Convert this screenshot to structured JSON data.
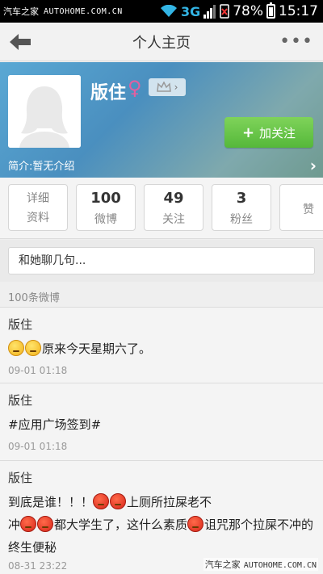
{
  "status_bar": {
    "watermark": "汽车之家",
    "domain": "AUTOHOME.COM.CN",
    "network": "3G",
    "battery": "78%",
    "battery_level": 0.78,
    "time": "15:17"
  },
  "header": {
    "title": "个人主页",
    "more": "•••"
  },
  "profile": {
    "username": "版住",
    "gender_icon": "female-icon",
    "gender_color": "#e35fa0",
    "follow_label": "加关注",
    "follow_color": "#5fbe43",
    "bio": "简介:暂无介绍"
  },
  "stats": {
    "details_line1": "详细",
    "details_line2": "资料",
    "weibo_num": "100",
    "weibo_label": "微博",
    "following_num": "49",
    "following_label": "关注",
    "fans_num": "3",
    "fans_label": "粉丝",
    "likes_label": "赞"
  },
  "chat": {
    "placeholder": "和她聊几句..."
  },
  "feed": {
    "count_label": "100条微博",
    "posts": [
      {
        "author": "版住",
        "text": "原来今天星期六了。",
        "time": "09-01 01:18"
      },
      {
        "author": "版住",
        "text": "#应用广场签到#",
        "time": "09-01 01:18"
      },
      {
        "author": "版住",
        "text_a": "到底是谁！！！",
        "text_b": "上厕所拉屎老不",
        "text_c": "冲",
        "text_d": "都大学生了，这什么素质",
        "text_e": "诅咒那个拉屎不冲的终生便秘",
        "time": "08-31 23:22"
      }
    ]
  },
  "footer": {
    "watermark": "汽车之家",
    "domain": "AUTOHOME.COM.CN"
  }
}
